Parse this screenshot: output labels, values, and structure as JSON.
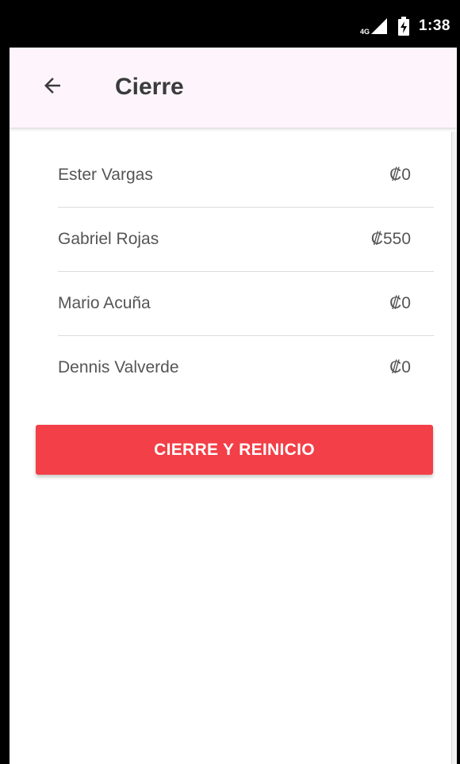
{
  "status_bar": {
    "network": "4G",
    "time": "1:38",
    "icons": [
      "signal-icon",
      "battery-charging-icon"
    ]
  },
  "app_bar": {
    "back_icon": "arrow-left-icon",
    "title": "Cierre"
  },
  "entries": [
    {
      "name": "Ester Vargas",
      "amount": "₡0"
    },
    {
      "name": "Gabriel Rojas",
      "amount": "₡550"
    },
    {
      "name": "Mario Acuña",
      "amount": "₡0"
    },
    {
      "name": "Dennis Valverde",
      "amount": "₡0"
    }
  ],
  "action_button": {
    "label": "CIERRE Y REINICIO",
    "color": "#f33f47"
  },
  "colors": {
    "app_bar_background": "#fdf5fb",
    "status_bar_background": "#000000",
    "text": "#555555"
  }
}
